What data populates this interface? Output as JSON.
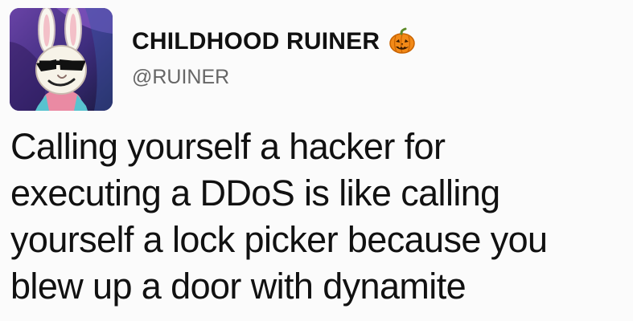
{
  "tweet": {
    "display_name": "CHILDHOOD RUINER",
    "handle": "@RUINER",
    "body_lines": [
      "Calling yourself a hacker for",
      "executing a DDoS is like calling",
      "yourself a lock picker because you",
      "blew up a door with dynamite"
    ],
    "name_emoji": "jack-o-lantern-icon",
    "avatar": "profile-avatar-cartoon-rabbit-with-sunglasses"
  },
  "colors": {
    "page_background": "#fbfbfb",
    "primary_text": "#111111",
    "secondary_text": "#666666",
    "avatar_purple": "#4a2f8a",
    "pumpkin_orange": "#f28a18"
  }
}
